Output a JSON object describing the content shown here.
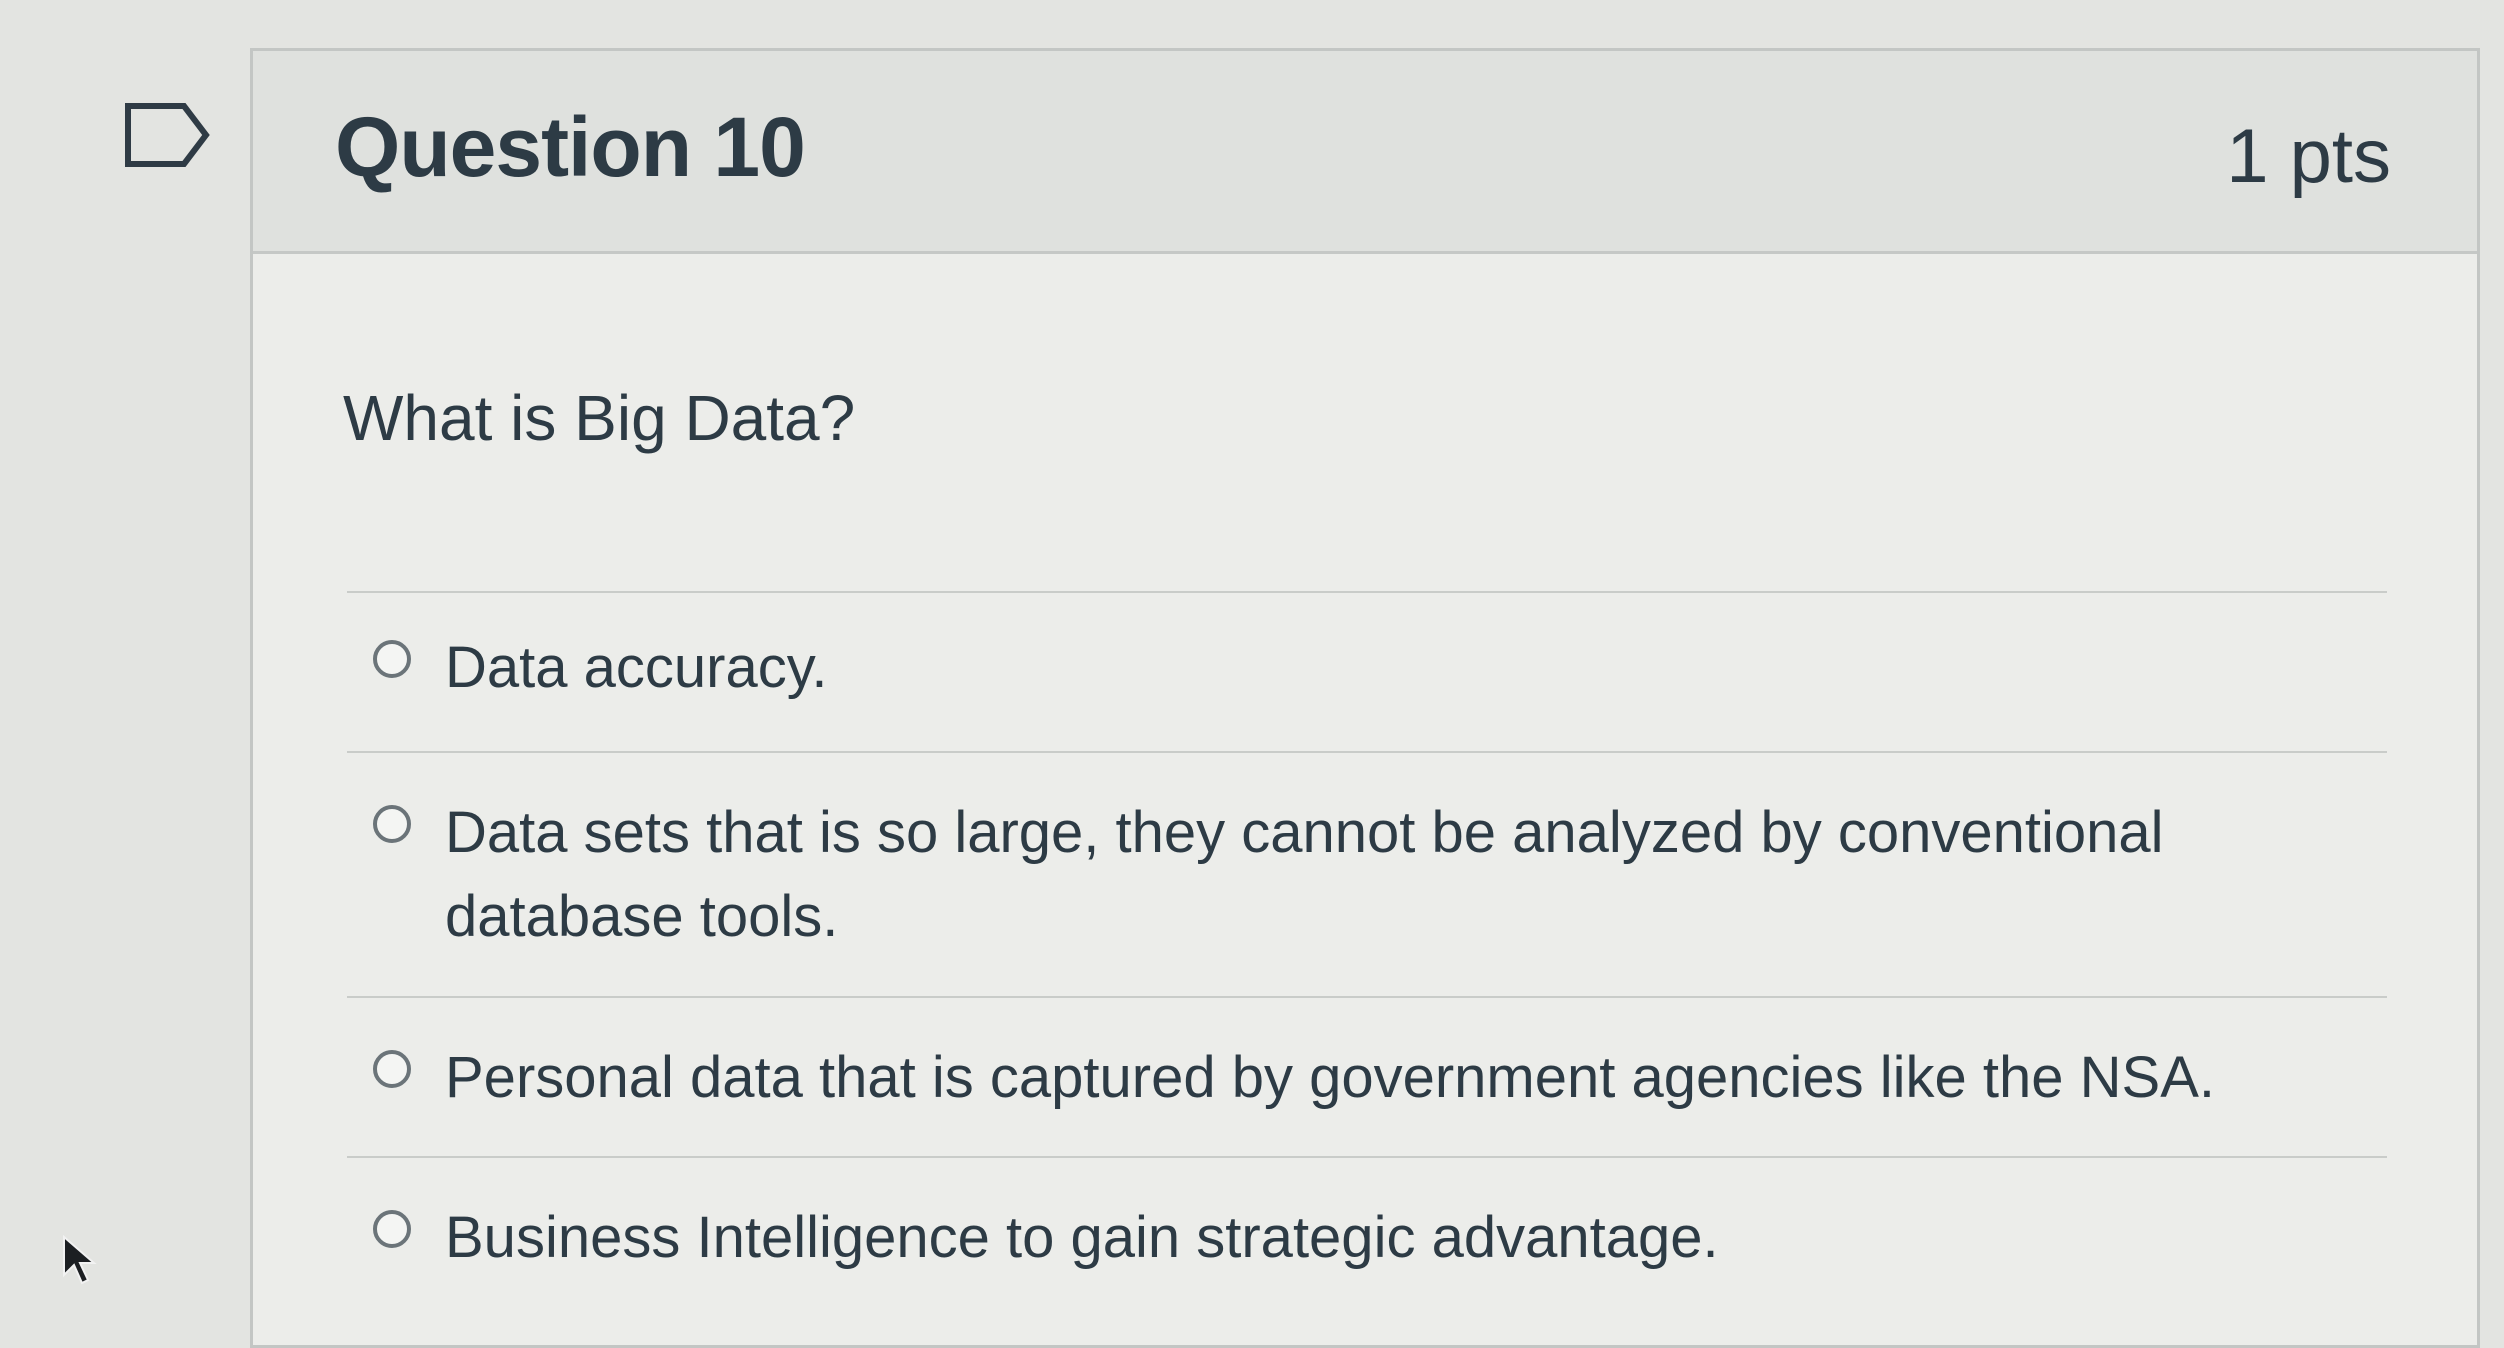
{
  "question": {
    "title": "Question 10",
    "points": "1 pts",
    "text": "What is Big Data?"
  },
  "answers": [
    {
      "label": "Data accuracy."
    },
    {
      "label": "Data sets that is so large, they cannot be analyzed by conventional database tools."
    },
    {
      "label": "Personal data that is captured by government agencies like the NSA."
    },
    {
      "label": "Business Intelligence to gain strategic advantage."
    }
  ],
  "icons": {
    "flag": "flag-outline-icon",
    "cursor": "mouse-pointer-icon"
  },
  "colors": {
    "page_background": "#e3e4e1",
    "card_background": "#ecedea",
    "header_background": "#dfe1de",
    "text": "#2d3b45",
    "border": "#c3c6c4"
  }
}
